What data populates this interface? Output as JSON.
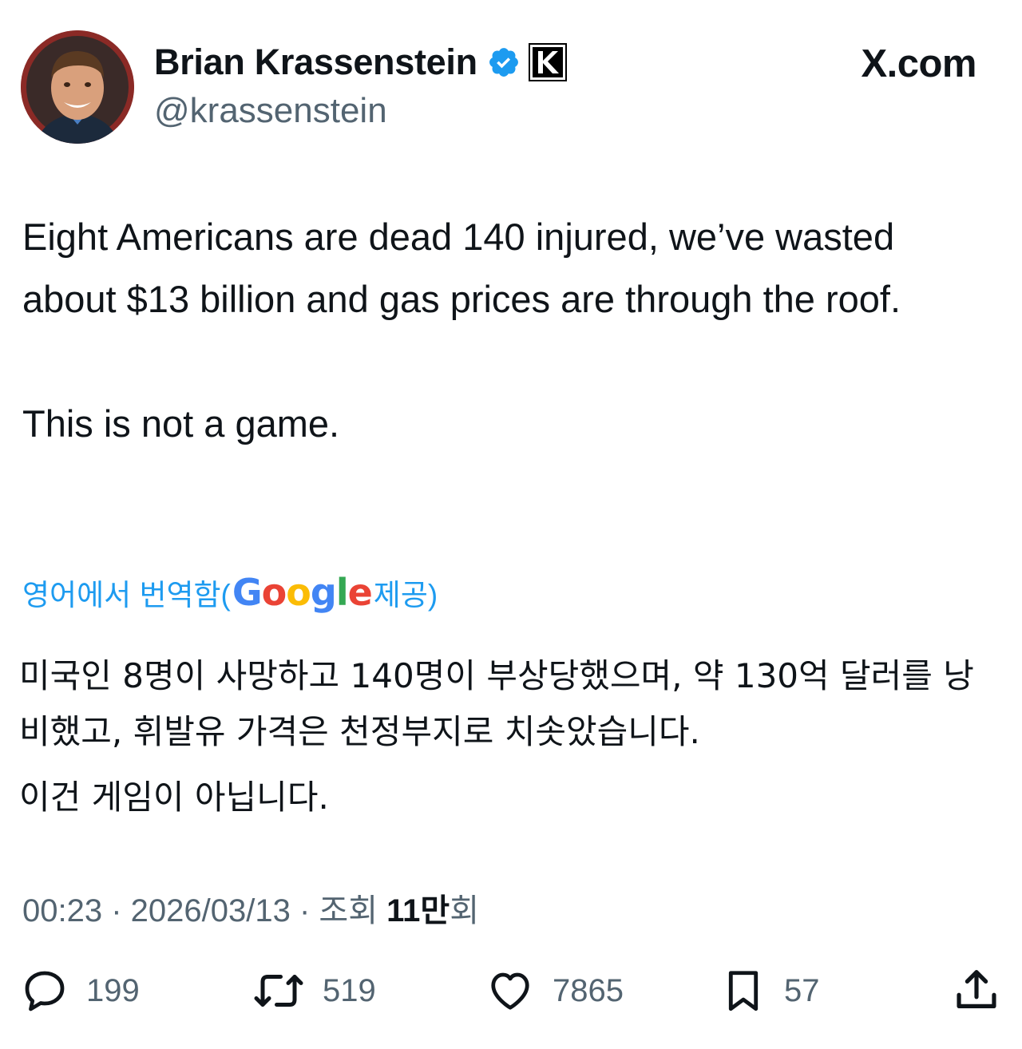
{
  "author": {
    "display_name": "Brian Krassenstein",
    "handle": "@krassenstein",
    "verified_icon": "verified-badge-icon",
    "affiliation_icon": "k-affiliation-logo-icon"
  },
  "brand": {
    "site": "X.com"
  },
  "tweet": {
    "text_en_p1": "Eight Americans are dead 140 injured, we’ve wasted about $13 billion and gas prices are through the roof.",
    "text_en_p2": "This is not a game.",
    "translation_label_start": "영어에서 번역함(",
    "translation_provider": "Google",
    "translation_label_end": " 제공)",
    "text_ko_p1": "미국인 8명이 사망하고 140명이 부상당했으며, 약 130억 달러를 낭비했고, 휘발유 가격은 천정부지로 치솟았습니다.",
    "text_ko_p2": "이건 게임이 아닙니다."
  },
  "meta": {
    "time": "00:23",
    "sep1": " · ",
    "date": "2026/03/13",
    "sep2": " · ",
    "views_label": "조회 ",
    "views_count": "11만",
    "views_suffix": "회"
  },
  "actions": {
    "replies": "199",
    "reposts": "519",
    "likes": "7865",
    "bookmarks": "57"
  },
  "colors": {
    "accent": "#1d9bf0",
    "text": "#0f1419",
    "secondary": "#536471"
  }
}
